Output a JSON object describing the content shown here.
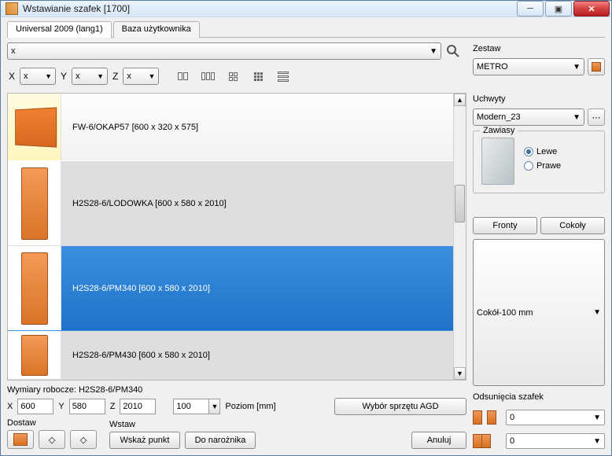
{
  "window": {
    "title": "Wstawianie szafek [1700]"
  },
  "tabs": [
    "Universal 2009 (lang1)",
    "Baza użytkownika"
  ],
  "filter_main": "x",
  "axes": {
    "x": "X",
    "y": "Y",
    "z": "Z",
    "xval": "x",
    "yval": "x",
    "zval": "x"
  },
  "items": [
    {
      "label": "FW-6/OKAP57  [600 x 320 x 575]"
    },
    {
      "label": "H2S28-6/LODOWKA  [600 x 580 x 2010]"
    },
    {
      "label": "H2S28-6/PM340  [600 x 580 x 2010]"
    },
    {
      "label": "H2S28-6/PM430  [600 x 580 x 2010]"
    }
  ],
  "sidebar": {
    "set_label": "Zestaw",
    "set_value": "METRO",
    "handles_label": "Uchwyty",
    "handles_value": "Modern_23",
    "hinges_label": "Zawiasy",
    "hinges_left": "Lewe",
    "hinges_right": "Prawe",
    "fronts_btn": "Fronty",
    "plinths_btn": "Cokoły",
    "plinth_value": "Cokół-100 mm",
    "offsets_label": "Odsunięcia szafek",
    "offset_h": "0",
    "offset_v": "0"
  },
  "dims": {
    "label_line": "Wymiary robocze: H2S28-6/PM340",
    "x": "600",
    "y": "580",
    "z": "2010",
    "level": "100",
    "level_label": "Poziom [mm]",
    "agd_btn": "Wybór sprzętu AGD"
  },
  "actions": {
    "dostaw": "Dostaw",
    "wstaw": "Wstaw",
    "wskaz": "Wskaż punkt",
    "corner": "Do narożnika",
    "cancel": "Anuluj"
  }
}
